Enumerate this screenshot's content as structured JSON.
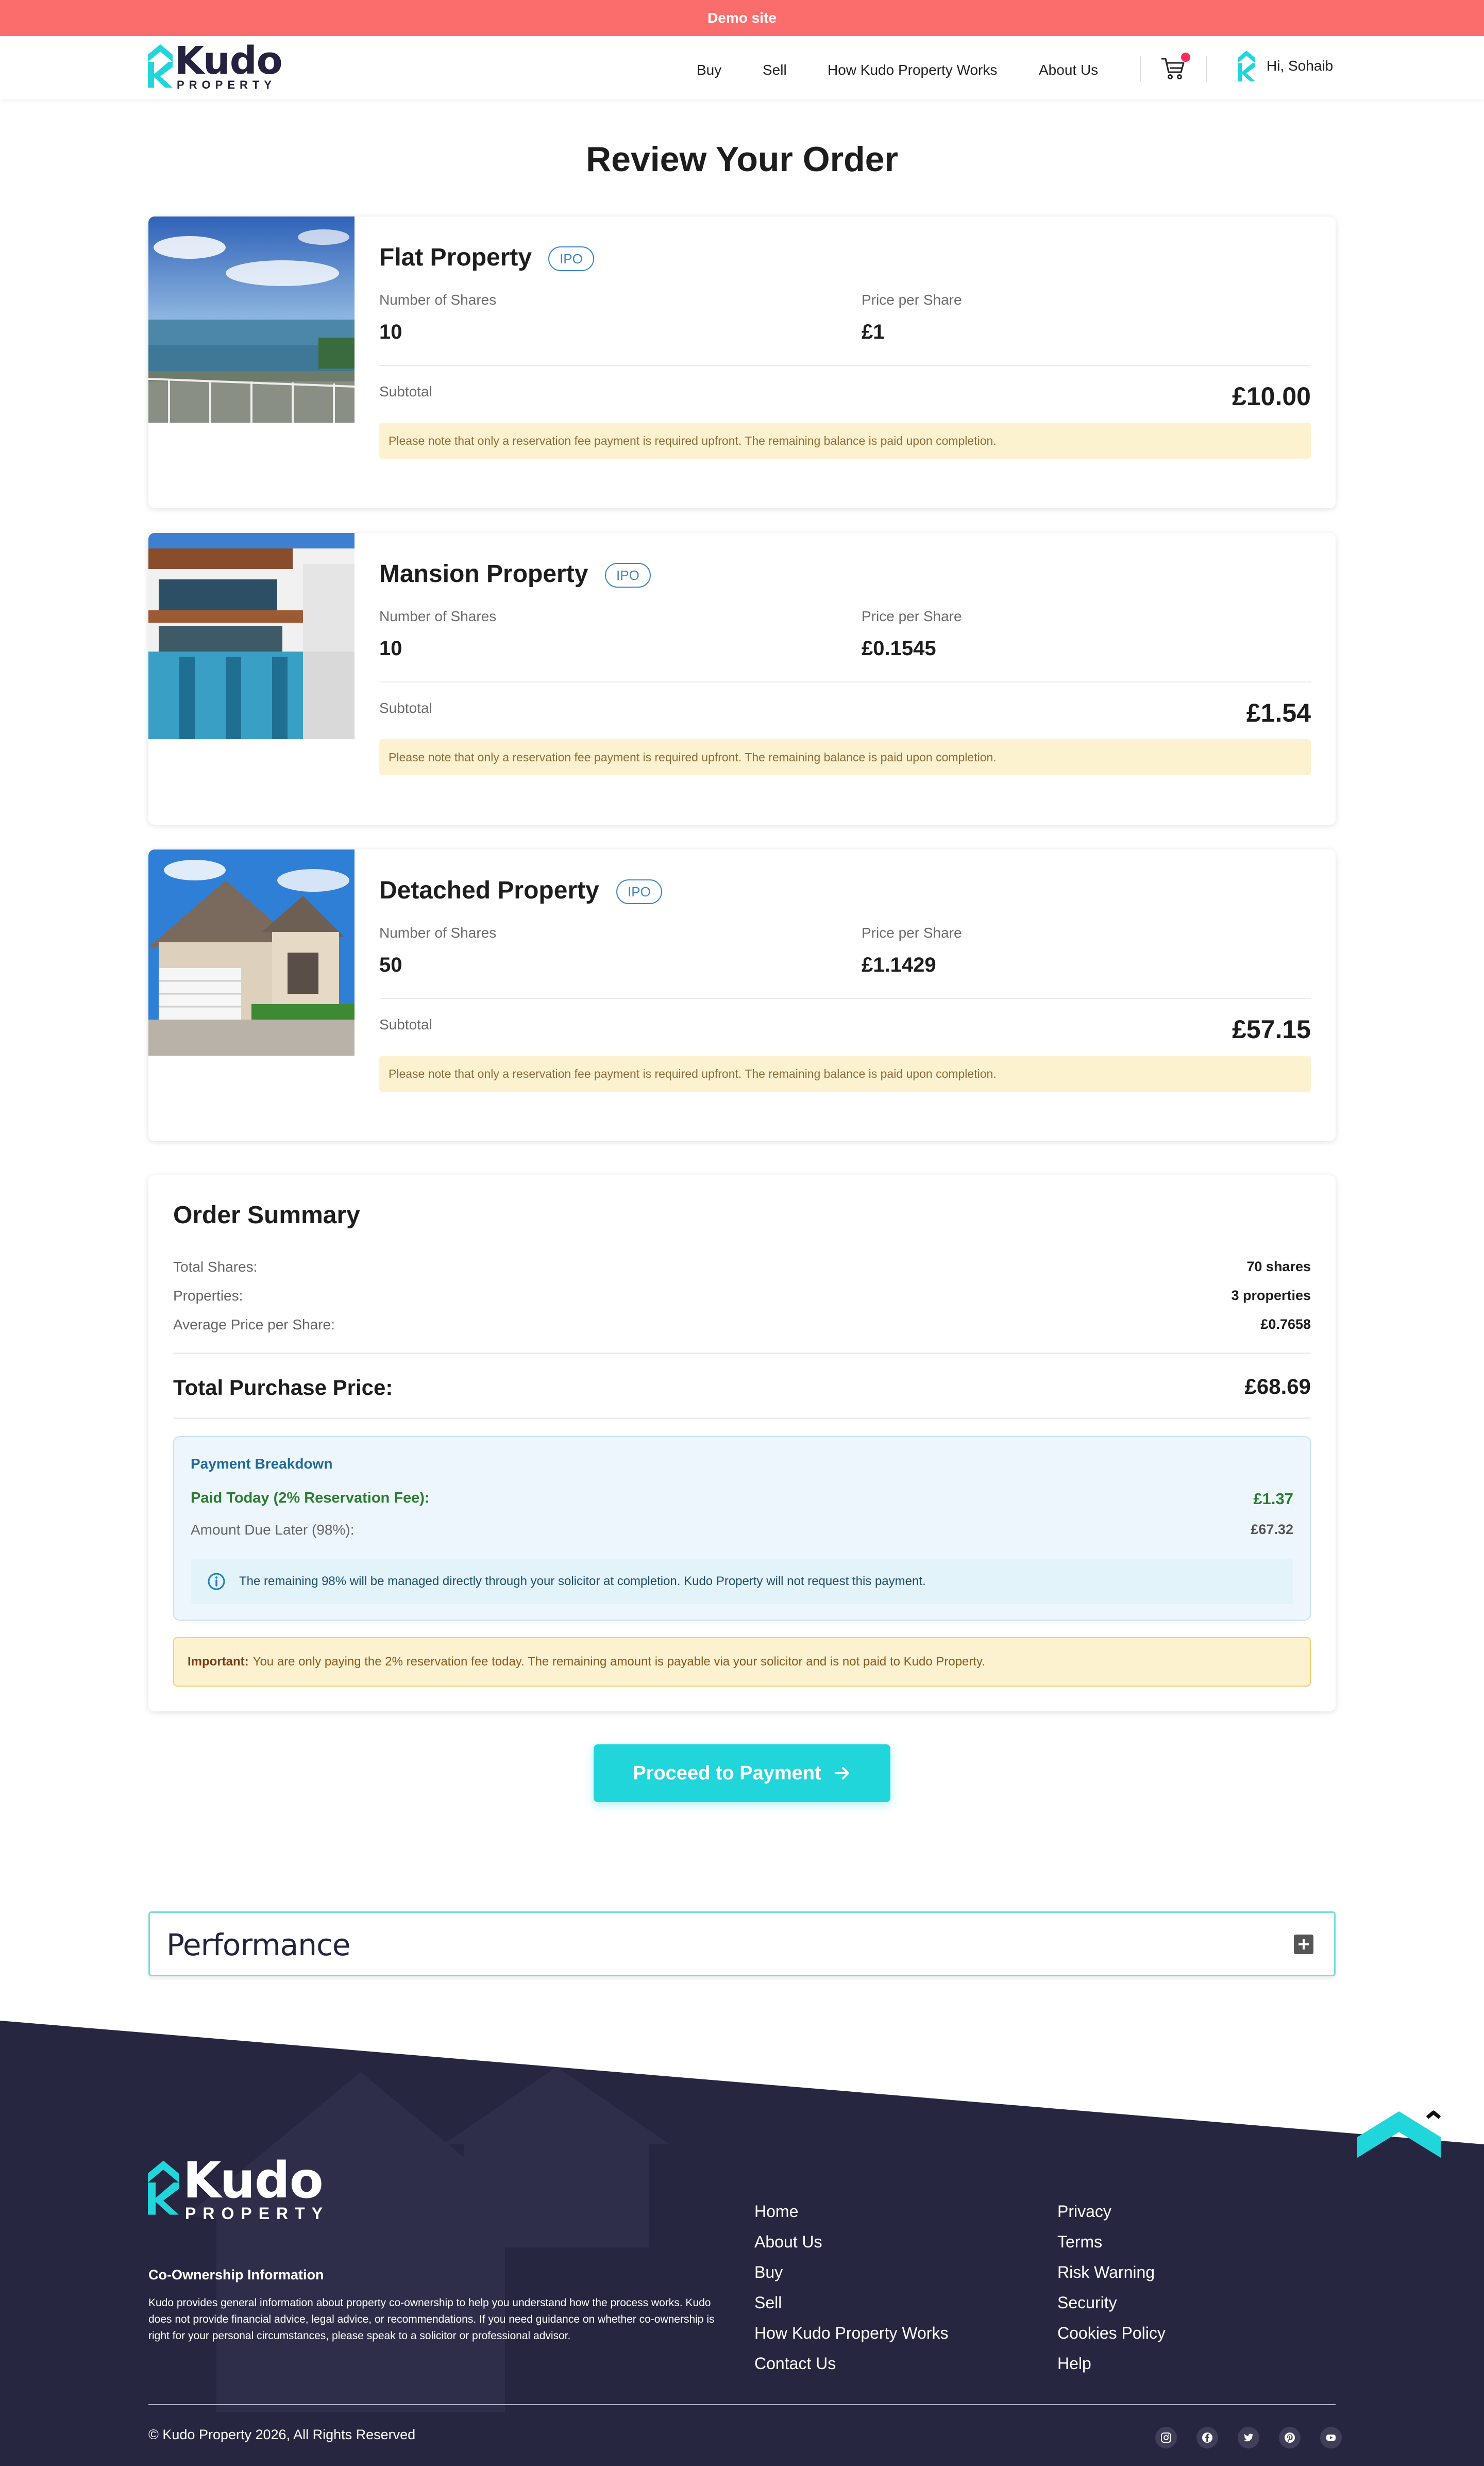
{
  "demo_banner": "Demo site",
  "brand": {
    "name": "Kudo",
    "sub": "PROPERTY"
  },
  "nav": {
    "items": [
      "Buy",
      "Sell",
      "How Kudo Property Works",
      "About Us"
    ],
    "greeting": "Hi, Sohaib"
  },
  "page_title": "Review Your Order",
  "labels": {
    "shares": "Number of Shares",
    "price": "Price per Share",
    "subtotal": "Subtotal",
    "note": "Please note that only a reservation fee payment is required upfront. The remaining balance is paid upon completion."
  },
  "properties": [
    {
      "title": "Flat Property",
      "badge": "IPO",
      "shares": "10",
      "price": "£1",
      "subtotal": "£10.00"
    },
    {
      "title": "Mansion Property",
      "badge": "IPO",
      "shares": "10",
      "price": "£0.1545",
      "subtotal": "£1.54"
    },
    {
      "title": "Detached Property",
      "badge": "IPO",
      "shares": "50",
      "price": "£1.1429",
      "subtotal": "£57.15"
    }
  ],
  "summary": {
    "title": "Order Summary",
    "rows": [
      {
        "label": "Total Shares:",
        "value": "70 shares"
      },
      {
        "label": "Properties:",
        "value": "3 properties"
      },
      {
        "label": "Average Price per Share:",
        "value": "£0.7658"
      }
    ],
    "total_label": "Total Purchase Price:",
    "total_value": "£68.69",
    "breakdown": {
      "title": "Payment Breakdown",
      "paid_label": "Paid Today (2% Reservation Fee):",
      "paid_value": "£1.37",
      "later_label": "Amount Due Later (98%):",
      "later_value": "£67.32",
      "info": "The remaining 98% will be managed directly through your solicitor at completion. Kudo Property will not request this payment."
    },
    "important_label": "Important:",
    "important_text": "You are only paying the 2% reservation fee today. The remaining amount is payable via your solicitor and is not paid to Kudo Property."
  },
  "proceed_label": "Proceed to Payment",
  "performance_label": "Performance",
  "footer": {
    "info_title": "Co-Ownership Information",
    "info_text": "Kudo provides general information about property co-ownership to help you understand how the process works. Kudo does not provide financial advice, legal advice, or recommendations. If you need guidance on whether co-ownership is right for your personal circumstances, please speak to a solicitor or professional advisor.",
    "col1": [
      "Home",
      "About Us",
      "Buy",
      "Sell",
      "How Kudo Property Works",
      "Contact Us"
    ],
    "col2": [
      "Privacy",
      "Terms",
      "Risk Warning",
      "Security",
      "Cookies Policy",
      "Help"
    ],
    "copyright": "© Kudo Property 2026, All Rights Reserved",
    "social": [
      "instagram-icon",
      "facebook-icon",
      "twitter-icon",
      "pinterest-icon",
      "youtube-icon"
    ]
  },
  "colors": {
    "demo_banner": "#fb6d6d",
    "accent": "#21d6da",
    "footer_bg": "#262640",
    "note_bg": "#fdf2cf",
    "badge": "#3a87c7"
  }
}
